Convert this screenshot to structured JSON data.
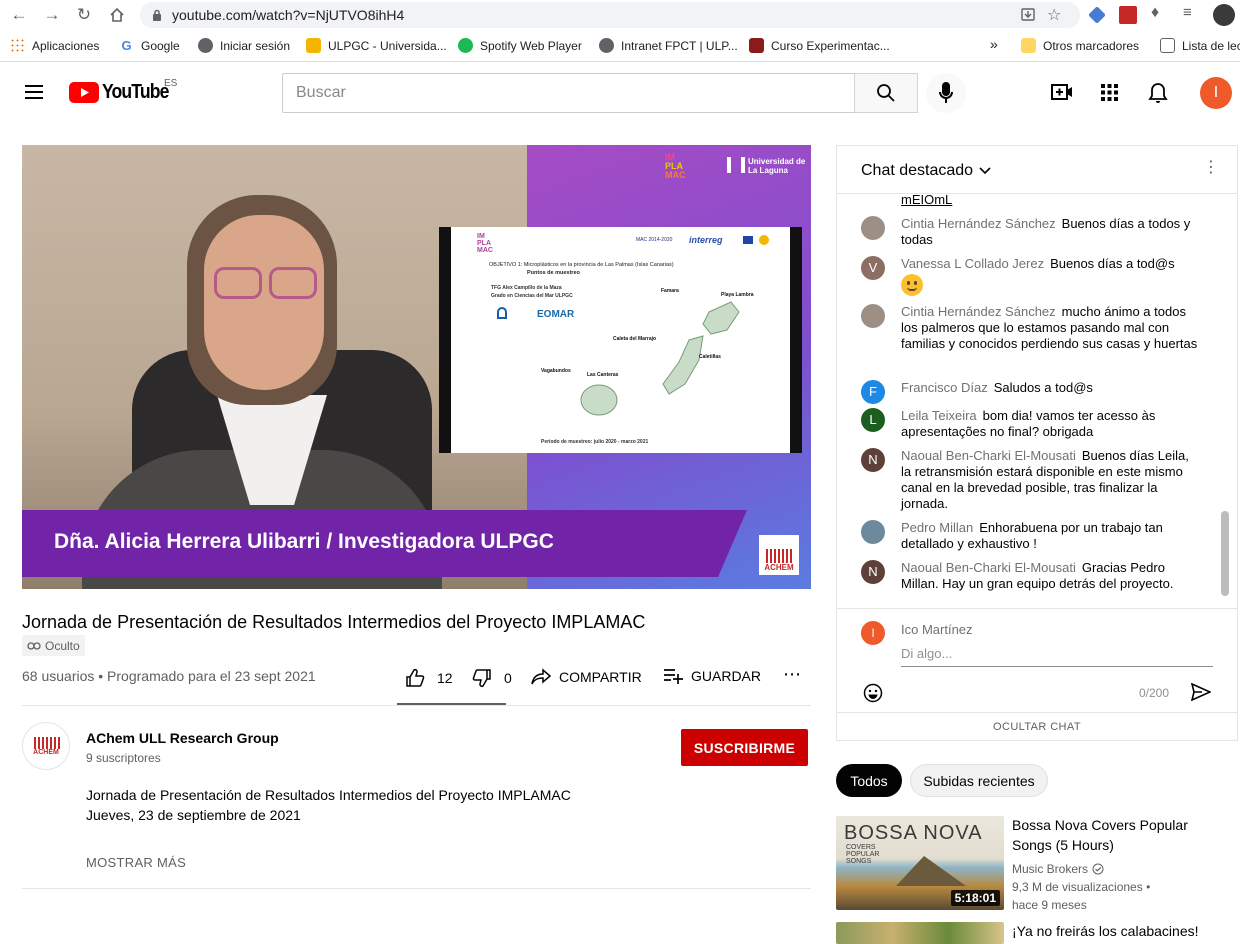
{
  "browser": {
    "url": "youtube.com/watch?v=NjUTVO8ihH4",
    "bookmarks": [
      {
        "label": "Aplicaciones",
        "color": "#e8710a"
      },
      {
        "label": "Google",
        "color": "#4285f4"
      },
      {
        "label": "Iniciar sesión",
        "color": "#5f6368"
      },
      {
        "label": "ULPGC - Universida...",
        "color": "#f4b400"
      },
      {
        "label": "Spotify Web Player",
        "color": "#1db954"
      },
      {
        "label": "Intranet FPCT | ULP...",
        "color": "#5f6368"
      },
      {
        "label": "Curso Experimentac...",
        "color": "#8b1a1a"
      }
    ],
    "more_bookmarks": "»",
    "other_bookmarks": "Otros marcadores",
    "reading_list": "Lista de lec"
  },
  "header": {
    "logo_text": "YouTube",
    "region": "ES",
    "search_placeholder": "Buscar",
    "avatar_letter": "I",
    "avatar_color": "#ef5a2a"
  },
  "video": {
    "lower_third": "Dña. Alicia Herrera Ulibarri / Investigadora ULPGC",
    "slide": {
      "logo_lines": [
        "IM",
        "PLA",
        "MAC"
      ],
      "objective": "OBJETIVO 1: Microplásticos en la provincia de Las Palmas (Islas Canarias)",
      "subtitle": "Puntos de muestreo",
      "tfg_line1": "TFG Alex Campillo de la Maza",
      "tfg_line2": "Grado en Ciencias del Mar ULPGC",
      "eomar": "EOMAR",
      "mac_label": "MAC 2014-2020",
      "interreg": "interreg",
      "places": [
        "Playa Lambra",
        "Famara",
        "Caleta del Marrajo",
        "Caletillas",
        "Vagabundos",
        "Las Canteras"
      ],
      "footer": "Periodo de muestreo: julio 2020 - marzo 2021"
    },
    "corner_logo_lines": [
      "IM",
      "PLA",
      "MAC"
    ],
    "university": "Universidad de La Laguna",
    "achem_label": "ACHEM"
  },
  "info": {
    "title": "Jornada de Presentación de Resultados Intermedios del Proyecto IMPLAMAC",
    "badge": "Oculto",
    "meta": "68 usuarios • Programado para el 23 sept 2021",
    "likes": "12",
    "dislikes": "0",
    "share": "COMPARTIR",
    "save": "GUARDAR"
  },
  "channel": {
    "name": "AChem ULL Research Group",
    "subs": "9 suscriptores",
    "subscribe": "SUSCRIBIRME",
    "avatar_text": "ACHEM",
    "desc_line1": "Jornada de Presentación de Resultados Intermedios del Proyecto IMPLAMAC",
    "desc_line2": "Jueves, 23 de septiembre de 2021",
    "show_more": "MOSTRAR MÁS"
  },
  "chat": {
    "header": "Chat destacado",
    "partial": "mEIOmL",
    "messages": [
      {
        "author": "Cintia Hernández Sánchez",
        "text": "Buenos días a todos y todas",
        "initial": "",
        "color": "#9e8f85"
      },
      {
        "author": "Vanessa L Collado Jerez",
        "text": "Buenos días a tod@s",
        "initial": "V",
        "color": "#8d6e63"
      },
      {
        "author": "Cintia Hernández Sánchez",
        "text": "mucho ánimo a todos los palmeros que lo estamos pasando mal con familias y conocidos perdiendo sus casas y huertas",
        "initial": "",
        "color": "#9e8f85"
      },
      {
        "author": "Francisco Díaz",
        "text": "Saludos a tod@s",
        "initial": "F",
        "color": "#1e88e5"
      },
      {
        "author": "Leila Teixeira",
        "text": "bom dia! vamos ter acesso às apresentações no final? obrigada",
        "initial": "L",
        "color": "#1b5e20"
      },
      {
        "author": "Naoual Ben-Charki El-Mousati",
        "text": "Buenos días Leila, la retransmisión estará disponible en este mismo canal en la brevedad posible, tras finalizar la jornada.",
        "initial": "N",
        "color": "#5d4037"
      },
      {
        "author": "Pedro Millan",
        "text": "Enhorabuena por un trabajo tan detallado y exhaustivo !",
        "initial": "",
        "color": "#6d8a9c"
      },
      {
        "author": "Naoual Ben-Charki El-Mousati",
        "text": "Gracias Pedro Millan. Hay un gran equipo detrás del proyecto.",
        "initial": "N",
        "color": "#5d4037"
      }
    ],
    "input_user": "Ico Martínez",
    "input_placeholder": "Di algo...",
    "counter": "0/200",
    "hide": "OCULTAR CHAT"
  },
  "recs": {
    "chips": [
      "Todos",
      "Subidas recientes"
    ],
    "items": [
      {
        "title": "Bossa Nova Covers Popular Songs (5 Hours)",
        "channel": "Music Brokers",
        "views": "9,3 M de visualizaciones •",
        "age": "hace 9 meses",
        "duration": "5:18:01",
        "thumb_title": "BOSSA NOVA",
        "thumb_sub1": "COVERS",
        "thumb_sub2": "POPULAR",
        "thumb_sub3": "SONGS"
      },
      {
        "title": "¡Ya no freirás los calabacines!"
      }
    ]
  }
}
